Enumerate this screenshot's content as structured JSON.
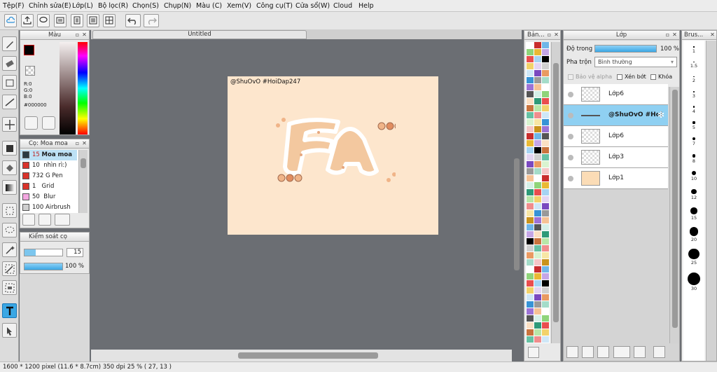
{
  "menu": [
    "Tệp(F)",
    "Chỉnh sửa(E)",
    "Lớp(L)",
    "Bộ lọc(R)",
    "Chọn(S)",
    "Chụp(N)",
    "Màu (C)",
    "Xem(V)",
    "Công cụ(T)",
    "Cửa sổ(W)",
    "Cloud",
    "Help"
  ],
  "document": {
    "tab_title": "Untitled",
    "signature": "@ShuOvO #HoiDap247"
  },
  "color_panel": {
    "title": "Màu",
    "r": "R:0",
    "g": "G:0",
    "b": "B:0",
    "hex": "#000000"
  },
  "brush_panel": {
    "title": "Cọ: Moa moa",
    "items": [
      {
        "size": "15",
        "name": "Moa moa",
        "color": "#2b3a43"
      },
      {
        "size": "10",
        "name": "nhìn rì:)",
        "color": "#d9332b"
      },
      {
        "size": "732",
        "name": "G Pen",
        "color": "#d9332b"
      },
      {
        "size": "1",
        "name": "Grid",
        "color": "#d9332b"
      },
      {
        "size": "50",
        "name": "Blur",
        "color": "#f3a7e0"
      },
      {
        "size": "100",
        "name": "Airbrush",
        "color": "#cfcfcf"
      }
    ]
  },
  "brush_control": {
    "title": "Kiểm soát cọ",
    "size_value": "15",
    "opacity_value": "100 %",
    "size_level": 0.3,
    "opacity_level": 1.0
  },
  "swatch_panel": {
    "title": "Bản..."
  },
  "layer_panel": {
    "title": "Lớp",
    "opacity_label": "Độ trong",
    "opacity_value": "100 %",
    "opacity_level": 1.0,
    "blend_label": "Pha trộn",
    "blend_value": "Bình thường",
    "protect_alpha": "Bảo vệ alpha",
    "clip": "Xén bớt",
    "lock": "Khóa",
    "layers": [
      {
        "name": "Lớp6",
        "selected": false
      },
      {
        "name": "@ShuOvO #Hoi",
        "selected": true
      },
      {
        "name": "Lớp6",
        "selected": false
      },
      {
        "name": "Lớp3",
        "selected": false
      },
      {
        "name": "Lớp1",
        "selected": false
      }
    ]
  },
  "brush_size_panel": {
    "title": "Brus...",
    "sizes": [
      "1",
      "1.5",
      "2",
      "3",
      "4",
      "5",
      "7",
      "8",
      "10",
      "12",
      "15",
      "20",
      "25",
      "30"
    ]
  },
  "status": {
    "text": "1600 * 1200 pixel  (11.6 * 8.7cm)  350 dpi  25 %  ( 27, 13 )"
  },
  "colors": {
    "accent": "#3aa7e4",
    "canvas_bg": "#fde6cd",
    "pale": "#f6dcc2"
  }
}
